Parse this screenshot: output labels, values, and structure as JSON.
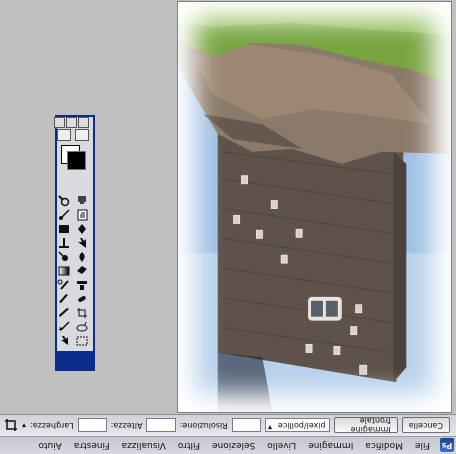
{
  "menu": {
    "items": [
      "File",
      "Modifica",
      "Immagine",
      "Livello",
      "Selezione",
      "Filtro",
      "Visualizza",
      "Finestra",
      "Aiuto"
    ]
  },
  "options": {
    "width_label": "Larghezza:",
    "height_label": "Altezza:",
    "resolution_label": "Risoluzione:",
    "unit_value": "pixel/pollice",
    "front_image_button": "Immagine frontale",
    "clear_button": "Cancella"
  },
  "toolbox": {
    "tools": [
      "marquee-icon",
      "move-icon",
      "lasso-icon",
      "magic-wand-icon",
      "crop-icon",
      "slice-icon",
      "healing-brush-icon",
      "brush-icon",
      "clone-stamp-icon",
      "history-brush-icon",
      "eraser-icon",
      "gradient-icon",
      "blur-icon",
      "dodge-icon",
      "path-selection-icon",
      "type-icon",
      "pen-icon",
      "shape-icon",
      "notes-icon",
      "eyedropper-icon",
      "hand-icon",
      "zoom-icon"
    ],
    "foreground_color": "#000000",
    "background_color": "#ffffff"
  }
}
